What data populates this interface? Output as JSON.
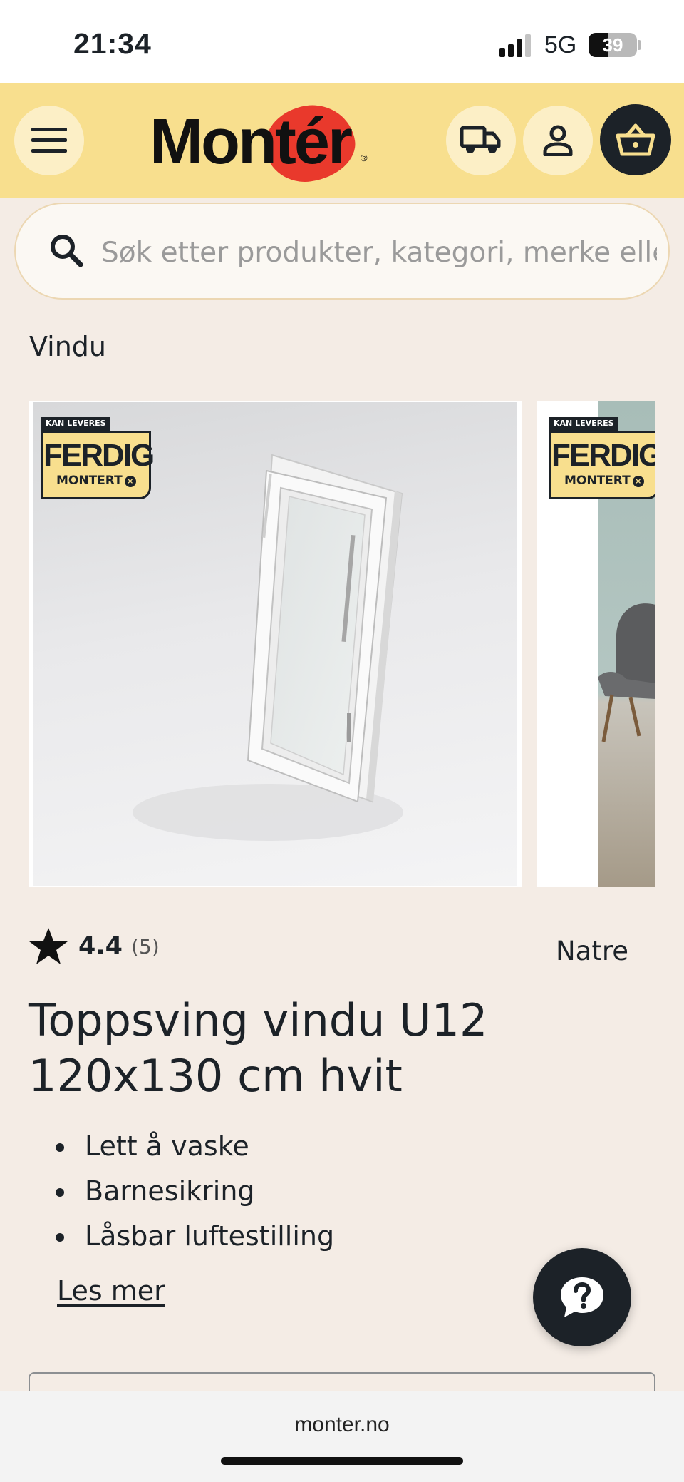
{
  "status_bar": {
    "time": "21:34",
    "network": "5G",
    "battery_level": "39",
    "battery_fraction": 0.39
  },
  "header": {
    "logo_text": "Montér",
    "logo_registered": "®",
    "icons": [
      "menu-icon",
      "truck-icon",
      "user-icon",
      "basket-icon"
    ],
    "colors": {
      "header_bg": "#f8df8e",
      "logo_accent": "#e9392c",
      "dark": "#1c2228"
    }
  },
  "search": {
    "placeholder": "Søk etter produkter, kategori, merke eller",
    "value": ""
  },
  "breadcrumb": "Vindu",
  "gallery": {
    "badges": [
      {
        "top": "KAN LEVERES",
        "big": "FERDIG",
        "small": "MONTERT"
      },
      {
        "top": "KAN LEVERES",
        "big": "FERDIG",
        "small": "MONTERT"
      }
    ],
    "badge_close_glyph": "×"
  },
  "product": {
    "rating": "4.4",
    "review_count": "(5)",
    "brand": "Natre",
    "title": "Toppsving vindu U12 120x130 cm hvit",
    "features": [
      "Lett å vaske",
      "Barnesikring",
      "Låsbar luftestilling"
    ],
    "read_more": "Les mer"
  },
  "help_button_icon": "question-chat-icon",
  "browser": {
    "url": "monter.no"
  }
}
